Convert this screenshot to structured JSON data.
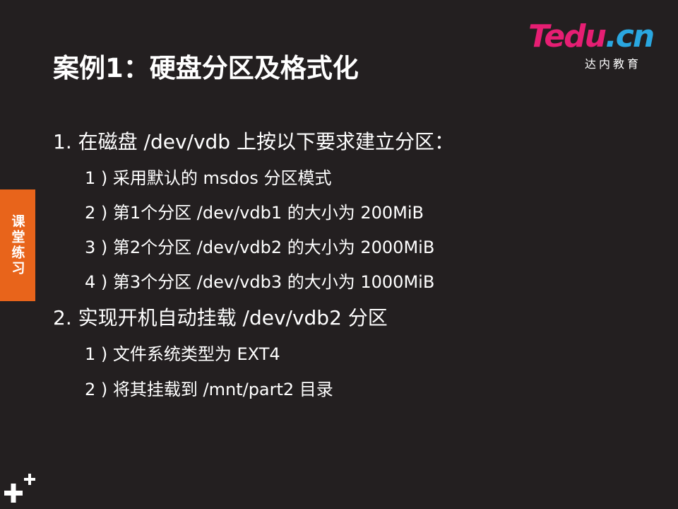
{
  "logo": {
    "brand_tedu": "Tedu",
    "brand_cn": ".cn",
    "subtitle": "达内教育"
  },
  "slide": {
    "title": "案例1：硬盘分区及格式化",
    "side_tab": "课堂练习",
    "items": [
      {
        "text": "1. 在磁盘 /dev/vdb 上按以下要求建立分区：",
        "subitems": [
          "1 ) 采用默认的 msdos 分区模式",
          "2 ) 第1个分区 /dev/vdb1 的大小为 200MiB",
          "3 ) 第2个分区 /dev/vdb2 的大小为 2000MiB",
          "4 ) 第3个分区 /dev/vdb3 的大小为 1000MiB"
        ]
      },
      {
        "text": "2. 实现开机自动挂载 /dev/vdb2 分区",
        "subitems": [
          "1 ) 文件系统类型为 EXT4",
          "2 ) 将其挂载到 /mnt/part2 目录"
        ]
      }
    ]
  },
  "colors": {
    "background": "#231f20",
    "accent_orange": "#e8641b",
    "logo_pink": "#e61e73",
    "logo_blue": "#2aa7e0"
  },
  "icons": [
    "plus-plus-icon"
  ]
}
